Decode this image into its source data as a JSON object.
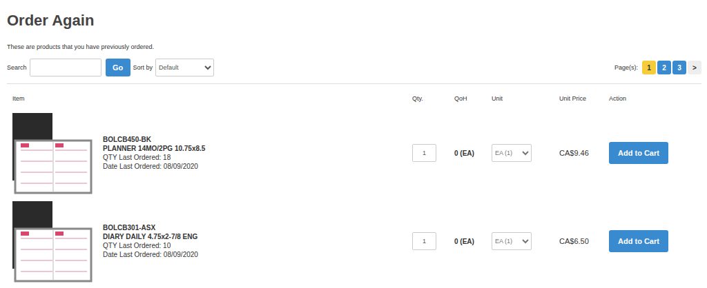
{
  "page": {
    "title": "Order Again",
    "subtitle": "These are products that you have previously ordered."
  },
  "search": {
    "label": "Search",
    "value": "",
    "button": "Go"
  },
  "sort": {
    "label": "Sort by",
    "value": "Default"
  },
  "pagination": {
    "label": "Page(s):",
    "pages": [
      {
        "label": "1",
        "selected": true
      },
      {
        "label": "2",
        "selected": false
      },
      {
        "label": "3",
        "selected": false
      }
    ],
    "next": ">"
  },
  "table": {
    "columns": [
      "Item",
      "Qty.",
      "QoH",
      "Unit",
      "Unit Price",
      "Action"
    ],
    "rows": [
      {
        "sku": "BOLCB450-BK",
        "name": "PLANNER 14MO/2PG 10.75x8.5",
        "last_qty": "QTY Last Ordered: 18",
        "last_date": "Date Last Ordered: 08/09/2020",
        "qty": "1",
        "qoh": "0 (EA)",
        "unit": "EA (1)",
        "price": "CA$9.46",
        "action": "Add to Cart"
      },
      {
        "sku": "BOLCB301-ASX",
        "name": "DIARY DAILY 4.75x2-7/8 ENG",
        "last_qty": "QTY Last Ordered: 10",
        "last_date": "Date Last Ordered: 08/09/2020",
        "qty": "1",
        "qoh": "0 (EA)",
        "unit": "EA (1)",
        "price": "CA$6.50",
        "action": "Add to Cart"
      }
    ]
  }
}
